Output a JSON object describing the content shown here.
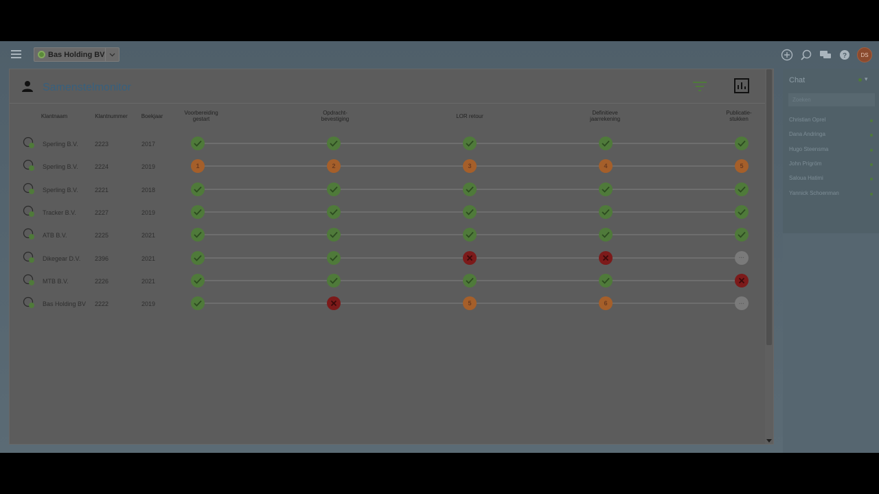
{
  "topbar": {
    "company": "Bas Holding BV",
    "avatar_initials": "DS",
    "icons": [
      "plus-circle-icon",
      "search-icon",
      "chat-bubbles-icon",
      "help-icon"
    ]
  },
  "panel": {
    "title": "Samenstelmonitor",
    "columns": {
      "klantnaam": "Klantnaam",
      "klantnummer": "Klantnummer",
      "boekjaar": "Boekjaar",
      "voorbereiding_1": "Voorbereiding",
      "voorbereiding_2": "gestart",
      "opdracht_1": "Opdracht-",
      "opdracht_2": "bevestiging",
      "lor": "LOR retour",
      "definitieve_1": "Definitieve",
      "definitieve_2": "jaarrekening",
      "publicatie_1": "Publicatie-",
      "publicatie_2": "stukken"
    },
    "rows": [
      {
        "name": "Sperling B.V.",
        "number": "2223",
        "year": "2017",
        "steps": [
          "ok",
          "ok",
          "ok",
          "ok",
          "ok"
        ]
      },
      {
        "name": "Sperling B.V.",
        "number": "2224",
        "year": "2019",
        "steps": [
          "1",
          "2",
          "3",
          "4",
          "5"
        ]
      },
      {
        "name": "Sperling B.V.",
        "number": "2221",
        "year": "2018",
        "steps": [
          "ok",
          "ok",
          "ok",
          "ok",
          "ok"
        ]
      },
      {
        "name": "Tracker B.V.",
        "number": "2227",
        "year": "2019",
        "steps": [
          "ok",
          "ok",
          "ok",
          "ok",
          "ok"
        ]
      },
      {
        "name": "ATB B.V.",
        "number": "2225",
        "year": "2021",
        "steps": [
          "ok",
          "ok",
          "ok",
          "ok",
          "ok"
        ]
      },
      {
        "name": "Dikegear D.V.",
        "number": "2396",
        "year": "2021",
        "steps": [
          "ok",
          "ok",
          "x",
          "x",
          "pending"
        ]
      },
      {
        "name": "MTB B.V.",
        "number": "2226",
        "year": "2021",
        "steps": [
          "ok",
          "ok",
          "ok",
          "ok",
          "x"
        ]
      },
      {
        "name": "Bas Holding BV",
        "number": "2222",
        "year": "2019",
        "steps": [
          "ok",
          "x",
          "5",
          "6",
          "pending"
        ]
      }
    ]
  },
  "chat": {
    "title": "Chat",
    "search_placeholder": "Zoeken",
    "contacts": [
      "Christian Oprel",
      "Dana Andringa",
      "Hugo Steensma",
      "John Prigröm",
      "Saloua Hatimi",
      "Yannick Schoenman"
    ]
  },
  "colors": {
    "ok": "#4f7a3a",
    "numbered": "#a55f2a",
    "error": "#7c1a1a",
    "pending": "#7a7a7a",
    "title": "#37607e"
  }
}
